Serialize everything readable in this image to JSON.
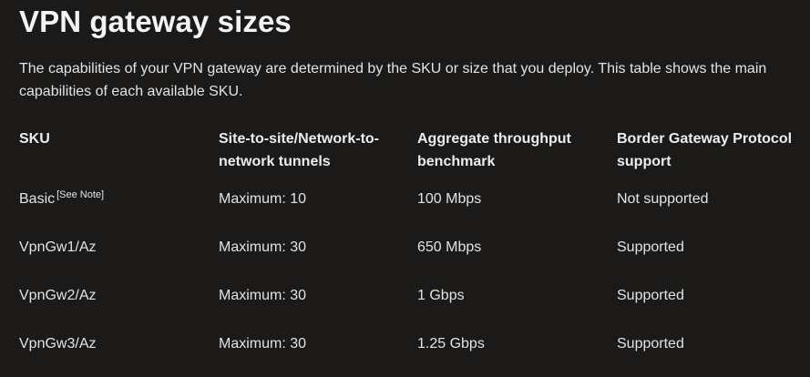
{
  "heading": "VPN gateway sizes",
  "intro": "The capabilities of your VPN gateway are determined by the SKU or size that you deploy. This table shows the main capabilities of each available SKU.",
  "table": {
    "headers": [
      "SKU",
      "Site-to-site/Network-to-network tunnels",
      "Aggregate throughput benchmark",
      "Border Gateway Protocol support"
    ],
    "rows": [
      {
        "sku": "Basic",
        "note": "[See Note]",
        "tunnels": "Maximum: 10",
        "throughput": "100 Mbps",
        "bgp": "Not supported"
      },
      {
        "sku": "VpnGw1/Az",
        "note": "",
        "tunnels": "Maximum: 30",
        "throughput": "650 Mbps",
        "bgp": "Supported"
      },
      {
        "sku": "VpnGw2/Az",
        "note": "",
        "tunnels": "Maximum: 30",
        "throughput": "1 Gbps",
        "bgp": "Supported"
      },
      {
        "sku": "VpnGw3/Az",
        "note": "",
        "tunnels": "Maximum: 30",
        "throughput": "1.25 Gbps",
        "bgp": "Supported"
      }
    ]
  }
}
